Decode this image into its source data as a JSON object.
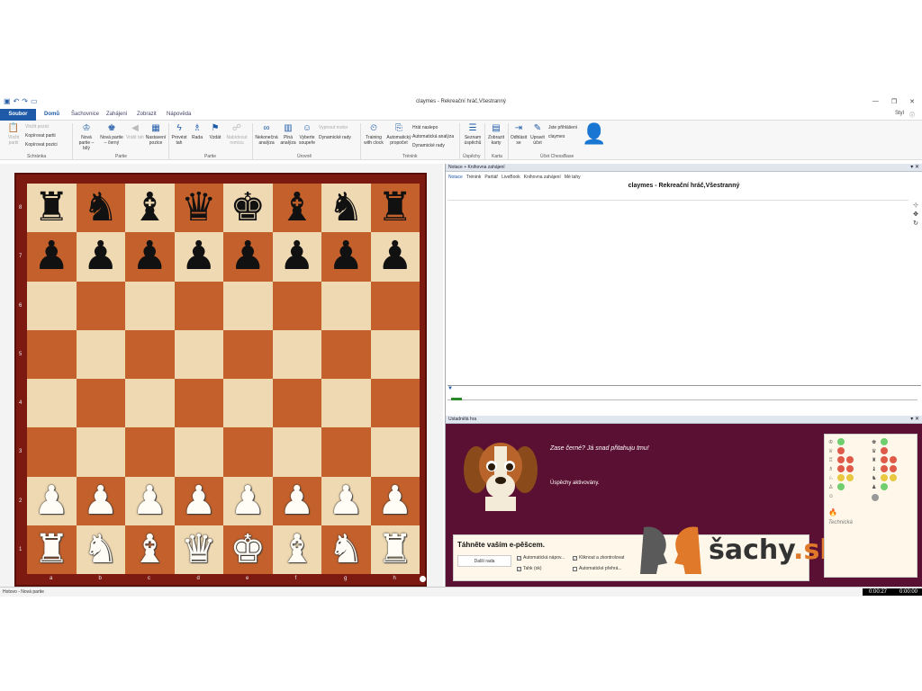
{
  "window": {
    "title": "claymes - Rekreační hráč,Všestranný",
    "style_label": "Styl"
  },
  "tabs": [
    "Soubor",
    "Domů",
    "Šachovnice",
    "Zahájení",
    "Zobrazit",
    "Nápověda"
  ],
  "ribbon": {
    "clipboard": {
      "paste": "Vložit partii",
      "paste_pos": "Vložit pozici",
      "copy_game": "Kopírovat partii",
      "copy_pos": "Kopírovat pozici",
      "group": "Schránka"
    },
    "game": {
      "new_white": "Nová partie – bílý",
      "new_black": "Nová partie – černý",
      "take_back": "Vrátit tah",
      "setup": "Nastavení pozice",
      "group": "Partie"
    },
    "play": {
      "play_move": "Provést tah",
      "hint": "Rada",
      "resign": "Vzdát",
      "draw": "Nabídnout remízu",
      "group": "Partie"
    },
    "level": {
      "inconclusive": "Nekonečná analýza",
      "full": "Plná analýza",
      "choose": "Vyberte soupeře",
      "engine_off": "Vypnout motor",
      "dynamic": "Dynamické rady",
      "group": "Úrovně"
    },
    "training": {
      "clock": "Training with clock",
      "auto": "Automatický propočet",
      "blind": "Hrát naslepo",
      "auto_analysis": "Automatická analýza",
      "dyn": "Dynamické rady",
      "group": "Trénink"
    },
    "success": {
      "list": "Seznam úspěchů",
      "group": "Úspěchy"
    },
    "card": {
      "show": "Zobrazit karty",
      "group": "Karta"
    },
    "account": {
      "logout": "Odhlásit se",
      "edit": "Upravit účet",
      "logged": "Jste přihlášeni",
      "user": "claymes",
      "group": "Účet ChessBase"
    }
  },
  "board": {
    "rows": [
      [
        "♜",
        "♞",
        "♝",
        "♛",
        "♚",
        "♝",
        "♞",
        "♜"
      ],
      [
        "♟",
        "♟",
        "♟",
        "♟",
        "♟",
        "♟",
        "♟",
        "♟"
      ],
      [
        "",
        "",
        "",
        "",
        "",
        "",
        "",
        ""
      ],
      [
        "",
        "",
        "",
        "",
        "",
        "",
        "",
        ""
      ],
      [
        "",
        "",
        "",
        "",
        "",
        "",
        "",
        ""
      ],
      [
        "",
        "",
        "",
        "",
        "",
        "",
        "",
        ""
      ],
      [
        "♟",
        "♟",
        "♟",
        "♟",
        "♟",
        "♟",
        "♟",
        "♟"
      ],
      [
        "♜",
        "♞",
        "♝",
        "♛",
        "♚",
        "♝",
        "♞",
        "♜"
      ]
    ],
    "ranks": [
      "8",
      "7",
      "6",
      "5",
      "4",
      "3",
      "2",
      "1"
    ],
    "files": [
      "a",
      "b",
      "c",
      "d",
      "e",
      "f",
      "g",
      "h"
    ]
  },
  "notation": {
    "panel_title": "Notace + Knihovna zahájení",
    "tabs": [
      "Notace",
      "Trénink",
      "Partiář",
      "LiveBook",
      "Knihovna zahájení",
      "Mé tahy"
    ],
    "heading": "claymes - Rekreační hráč,Všestranný"
  },
  "coach": {
    "panel_title": "Ustadnělá hra",
    "message": "Zase černé? Já snad přitahuju tmu!",
    "achievements": "Úspěchy aktivovány.",
    "prompt": "Táhněte vaším e-pěšcem.",
    "next_hint": "Další rada",
    "opt_auto_hint": "Automatická nápov...",
    "opt_click": "Kliknout a zkontrolovat",
    "opt_move": "Tahk (ok)",
    "opt_auto_move": "Automatické přehrá...",
    "logo_prefix": "šachy",
    "logo_suffix": ".sk",
    "technical": "Technická"
  },
  "status": {
    "text": "Hotovo - Nová partie",
    "clock_white": "0:00:27",
    "clock_black": "0:00:00"
  }
}
